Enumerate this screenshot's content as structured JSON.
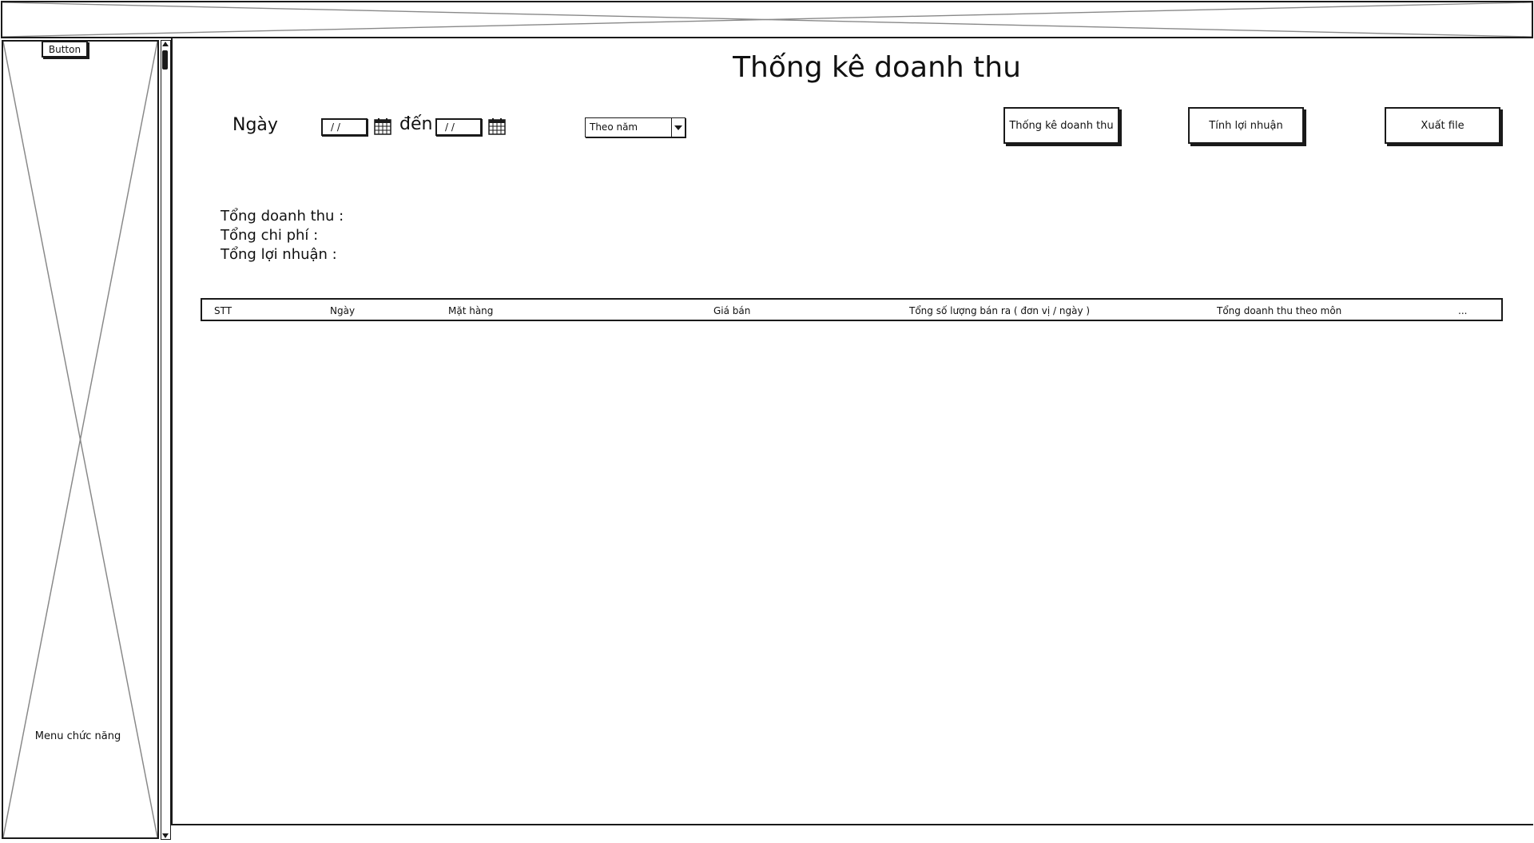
{
  "sidebar": {
    "button_label": "Button",
    "menu_label": "Menu chức năng"
  },
  "page": {
    "title": "Thống kê doanh thu"
  },
  "filters": {
    "date_label": "Ngày",
    "from_date": "/ /",
    "to_label": "đến",
    "to_date": "/ /",
    "period_select": "Theo năm"
  },
  "actions": {
    "revenue_stats": "Thống kê doanh thu",
    "profit_calc": "Tính lợi nhuận",
    "export_file": "Xuất file"
  },
  "summary": {
    "total_revenue": "Tổng doanh thu :",
    "total_cost": "Tổng chi phí :",
    "total_profit": "Tổng lợi nhuận :"
  },
  "table": {
    "columns": [
      "STT",
      "Ngày",
      "Mặt hàng",
      "Giá bán",
      "Tổng số lượng bán ra ( đơn vị / ngày )",
      "Tổng doanh thu theo môn",
      "..."
    ]
  }
}
